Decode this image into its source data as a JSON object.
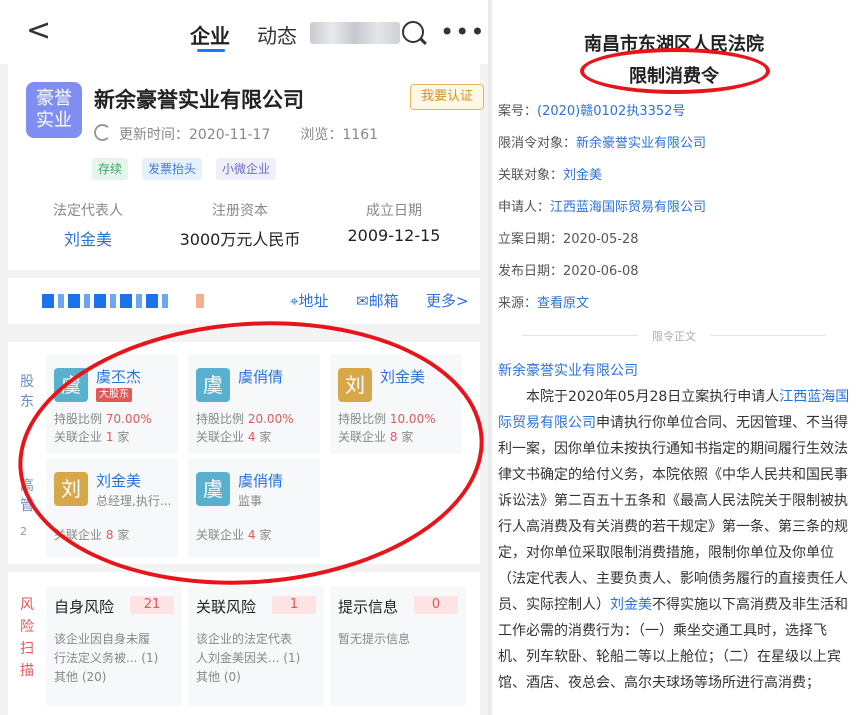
{
  "header": {
    "back_label": "<",
    "tab_company": "企业",
    "tab_news": "动态"
  },
  "company": {
    "logo_line1": "豪誉",
    "logo_line2": "实业",
    "name": "新余豪誉实业有限公司",
    "claim_label": "我要认证",
    "update_label": "更新时间：2020-11-17",
    "views_label": "浏览：1161",
    "tags": [
      "存续",
      "发票抬头",
      "小微企业"
    ],
    "stats": [
      {
        "label": "法定代表人",
        "value": "刘金美"
      },
      {
        "label": "注册资本",
        "value": "3000万元人民币"
      },
      {
        "label": "成立日期",
        "value": "2009-12-15"
      }
    ]
  },
  "contact": {
    "address_label": "地址",
    "email_label": "邮箱",
    "more_label": "更多>"
  },
  "shareholders": {
    "section_label_shareholders": "股东",
    "section_label_executives": "高管",
    "executive_count": "2",
    "shareholder_cards": [
      {
        "avatar": "虞",
        "name": "虞丕杰",
        "badge": "大股东",
        "ratio_label": "持股比例",
        "ratio": "70.00%",
        "related_label": "关联企业",
        "related_count": "1",
        "related_unit": "家"
      },
      {
        "avatar": "虞",
        "name": "虞俏倩",
        "ratio_label": "持股比例",
        "ratio": "20.00%",
        "related_label": "关联企业",
        "related_count": "4",
        "related_unit": "家"
      },
      {
        "avatar": "刘",
        "name": "刘金美",
        "ratio_label": "持股比例",
        "ratio": "10.00%",
        "related_label": "关联企业",
        "related_count": "8",
        "related_unit": "家"
      }
    ],
    "executive_cards": [
      {
        "avatar": "刘",
        "name": "刘金美",
        "role": "总经理,执行...",
        "related_label": "关联企业",
        "related_count": "8",
        "related_unit": "家"
      },
      {
        "avatar": "虞",
        "name": "虞俏倩",
        "role": "监事",
        "related_label": "关联企业",
        "related_count": "4",
        "related_unit": "家"
      }
    ]
  },
  "risk": {
    "section_label": "风险扫描",
    "cards": [
      {
        "title": "自身风险",
        "count": "21",
        "line1": "该企业因自身未履",
        "line2": "行法定义务被...",
        "line2_count": "(1)",
        "line3": "其他 (20)"
      },
      {
        "title": "关联风险",
        "count": "1",
        "line1": "该企业的法定代表",
        "line2": "人刘金美因关...",
        "line2_count": "(1)",
        "line3": "其他 (0)"
      },
      {
        "title": "提示信息",
        "count": "0",
        "line1": "暂无提示信息",
        "line2": "",
        "line2_count": "",
        "line3": ""
      }
    ]
  },
  "document": {
    "court": "南昌市东湖区人民法院",
    "title": "限制消费令",
    "fields": [
      {
        "label": "案号：",
        "value": "(2020)赣0102执3352号",
        "link": true
      },
      {
        "label": "限消令对象：",
        "value": "新余豪誉实业有限公司",
        "link": true
      },
      {
        "label": "关联对象：",
        "value": "刘金美",
        "link": true
      },
      {
        "label": "申请人：",
        "value": "江西蓝海国际贸易有限公司",
        "link": true
      },
      {
        "label": "立案日期：",
        "value": "2020-05-28",
        "link": false
      },
      {
        "label": "发布日期：",
        "value": "2020-06-08",
        "link": false
      },
      {
        "label": "来源：",
        "value": "查看原文",
        "link": true
      }
    ],
    "divider": "限令正文",
    "addressee": "新余豪誉实业有限公司",
    "body_p1": "本院于2020年05月28日立案执行申请人",
    "body_link1": "江西蓝海国际贸易有限公司",
    "body_p2": "申请执行你单位合同、无因管理、不当得利一案，因你单位未按执行通知书指定的期间履行生效法律文书确定的给付义务，本院依照《中华人民共和国民事诉讼法》第二百五十五条和《最高人民法院关于限制被执行人高消费及有关消费的若干规定》第一条、第三条的规定，对你单位采取限制消费措施，限制你单位及你单位（法定代表人、主要负责人、影响债务履行的直接责任人员、实际控制人）",
    "body_link2": "刘金美",
    "body_p3": "不得实施以下高消费及非生活和工作必需的消费行为：（一）乘坐交通工具时，选择飞机、列车软卧、轮船二等以上舱位；（二）在星级以上宾馆、酒店、夜总会、高尔夫球场等场所进行高消费；"
  },
  "colors": {
    "accent": "#2a72d9",
    "annotation_red": "#e8141a",
    "risk_red": "#e25858"
  }
}
